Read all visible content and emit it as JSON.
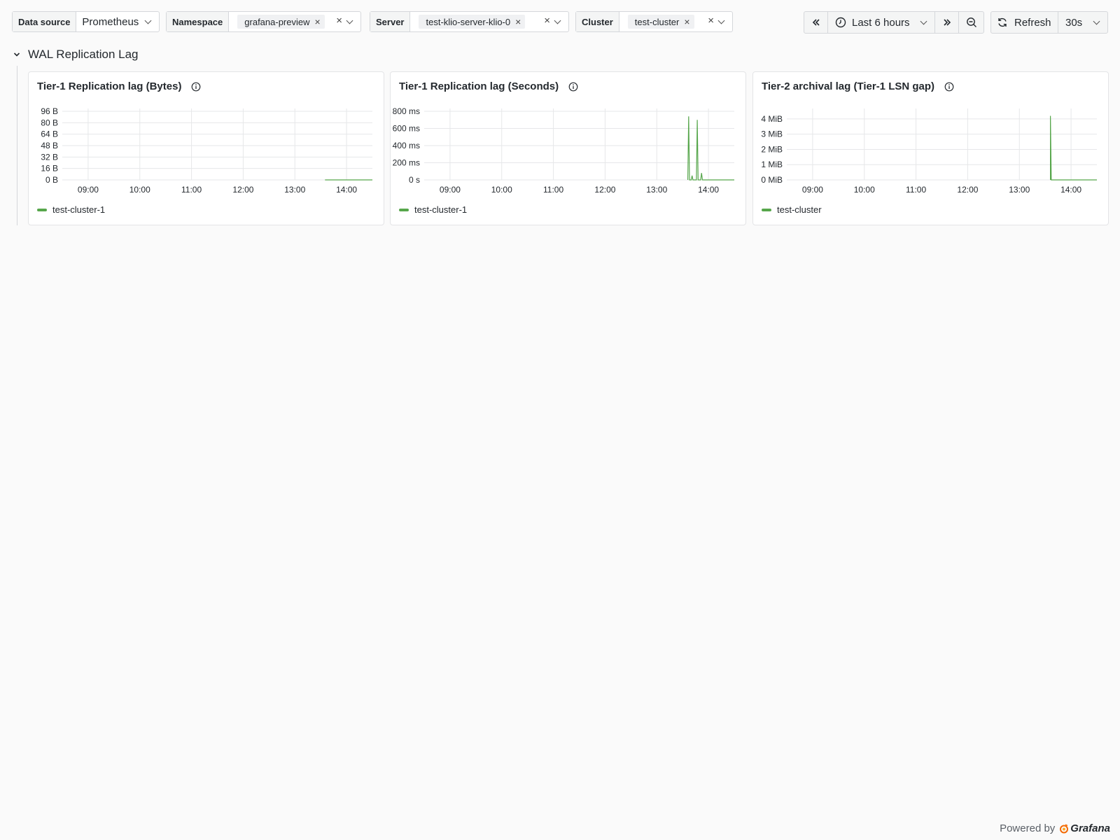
{
  "variables": {
    "datasource": {
      "label": "Data source",
      "value": "Prometheus"
    },
    "namespace": {
      "label": "Namespace",
      "chip": "grafana-preview"
    },
    "server": {
      "label": "Server",
      "chip": "test-klio-server-klio-0"
    },
    "cluster": {
      "label": "Cluster",
      "chip": "test-cluster"
    }
  },
  "timepicker": {
    "range": "Last 6 hours",
    "refresh_label": "Refresh",
    "interval": "30s"
  },
  "row": {
    "title": "WAL Replication Lag"
  },
  "colors": {
    "series": "#56a64b"
  },
  "icons": {
    "shift_back": "angle-double-left-icon",
    "clock": "clock-icon",
    "shift_forward": "angle-double-right-icon",
    "zoom_out": "zoom-out-icon",
    "refresh": "sync-icon",
    "info": "info-circle-icon",
    "collapse": "chevron-down-icon",
    "grafana_logo": "grafana-logo-icon"
  },
  "panels": [
    {
      "title": "Tier-1 Replication lag (Bytes)",
      "legend": "test-cluster-1"
    },
    {
      "title": "Tier-1 Replication lag (Seconds)",
      "legend": "test-cluster-1"
    },
    {
      "title": "Tier-2 archival lag (Tier-1 LSN gap)",
      "legend": "test-cluster"
    }
  ],
  "chart_data": [
    {
      "type": "line",
      "title": "Tier-1 Replication lag (Bytes)",
      "x_ticks": [
        "09:00",
        "10:00",
        "11:00",
        "12:00",
        "13:00",
        "14:00"
      ],
      "y_ticks": [
        "0 B",
        "16 B",
        "32 B",
        "48 B",
        "64 B",
        "80 B",
        "96 B"
      ],
      "ylim": [
        0,
        96
      ],
      "xlim": [
        "08:30",
        "14:30"
      ],
      "grid": true,
      "legend_position": "bottom-left",
      "series": [
        {
          "name": "test-cluster-1",
          "x": [
            "13:35",
            "14:30"
          ],
          "values": [
            0,
            0
          ]
        }
      ]
    },
    {
      "type": "line",
      "title": "Tier-1 Replication lag (Seconds)",
      "x_ticks": [
        "09:00",
        "10:00",
        "11:00",
        "12:00",
        "13:00",
        "14:00"
      ],
      "y_ticks": [
        "0 s",
        "200 ms",
        "400 ms",
        "600 ms",
        "800 ms"
      ],
      "ylim": [
        0,
        800
      ],
      "xlim": [
        "08:30",
        "14:30"
      ],
      "grid": true,
      "legend_position": "bottom-left",
      "series": [
        {
          "name": "test-cluster-1",
          "x": [
            "13:36",
            "13:37",
            "13:38",
            "13:40",
            "13:41",
            "13:42",
            "13:46",
            "13:47",
            "13:48",
            "13:51",
            "13:52",
            "13:53",
            "14:30"
          ],
          "values": [
            0,
            740,
            0,
            0,
            50,
            0,
            0,
            700,
            0,
            0,
            80,
            0,
            0
          ]
        }
      ]
    },
    {
      "type": "line",
      "title": "Tier-2 archival lag (Tier-1 LSN gap)",
      "x_ticks": [
        "09:00",
        "10:00",
        "11:00",
        "12:00",
        "13:00",
        "14:00"
      ],
      "y_ticks": [
        "0 MiB",
        "1 MiB",
        "2 MiB",
        "3 MiB",
        "4 MiB"
      ],
      "ylim": [
        0,
        4.5
      ],
      "xlim": [
        "08:30",
        "14:30"
      ],
      "grid": true,
      "legend_position": "bottom-left",
      "series": [
        {
          "name": "test-cluster",
          "x": [
            "13:36",
            "13:36",
            "13:37",
            "14:30"
          ],
          "values": [
            0,
            4.2,
            0,
            0
          ]
        }
      ]
    }
  ],
  "footer": {
    "powered_by": "Powered by",
    "brand": "Grafana"
  }
}
